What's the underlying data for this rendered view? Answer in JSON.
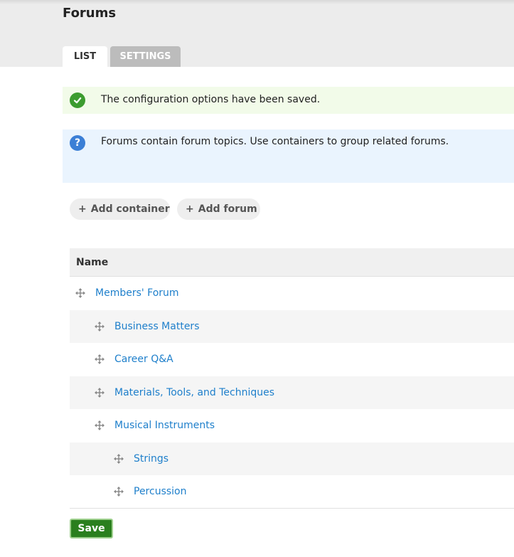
{
  "page": {
    "title": "Forums"
  },
  "tabs": [
    {
      "label": "List",
      "active": true
    },
    {
      "label": "Settings",
      "active": false
    }
  ],
  "messages": {
    "status": {
      "icon": "check-icon",
      "text": "The configuration options have been saved."
    },
    "help": {
      "icon": "question-icon",
      "text": "Forums contain forum topics. Use containers to group related forums."
    }
  },
  "actions": {
    "add_container": "Add container",
    "add_forum": "Add forum"
  },
  "table": {
    "header": "Name",
    "rows": [
      {
        "label": "Members' Forum",
        "depth": 0
      },
      {
        "label": "Business Matters",
        "depth": 1
      },
      {
        "label": "Career Q&A",
        "depth": 1
      },
      {
        "label": "Materials, Tools, and Techniques",
        "depth": 1
      },
      {
        "label": "Musical Instruments",
        "depth": 1
      },
      {
        "label": "Strings",
        "depth": 2
      },
      {
        "label": "Percussion",
        "depth": 2
      }
    ]
  },
  "save_label": "Save",
  "colors": {
    "link": "#1e7fcb",
    "status_bg": "#f2fbe9",
    "help_bg": "#eaf4fe",
    "save_bg": "#2a7f1e"
  }
}
